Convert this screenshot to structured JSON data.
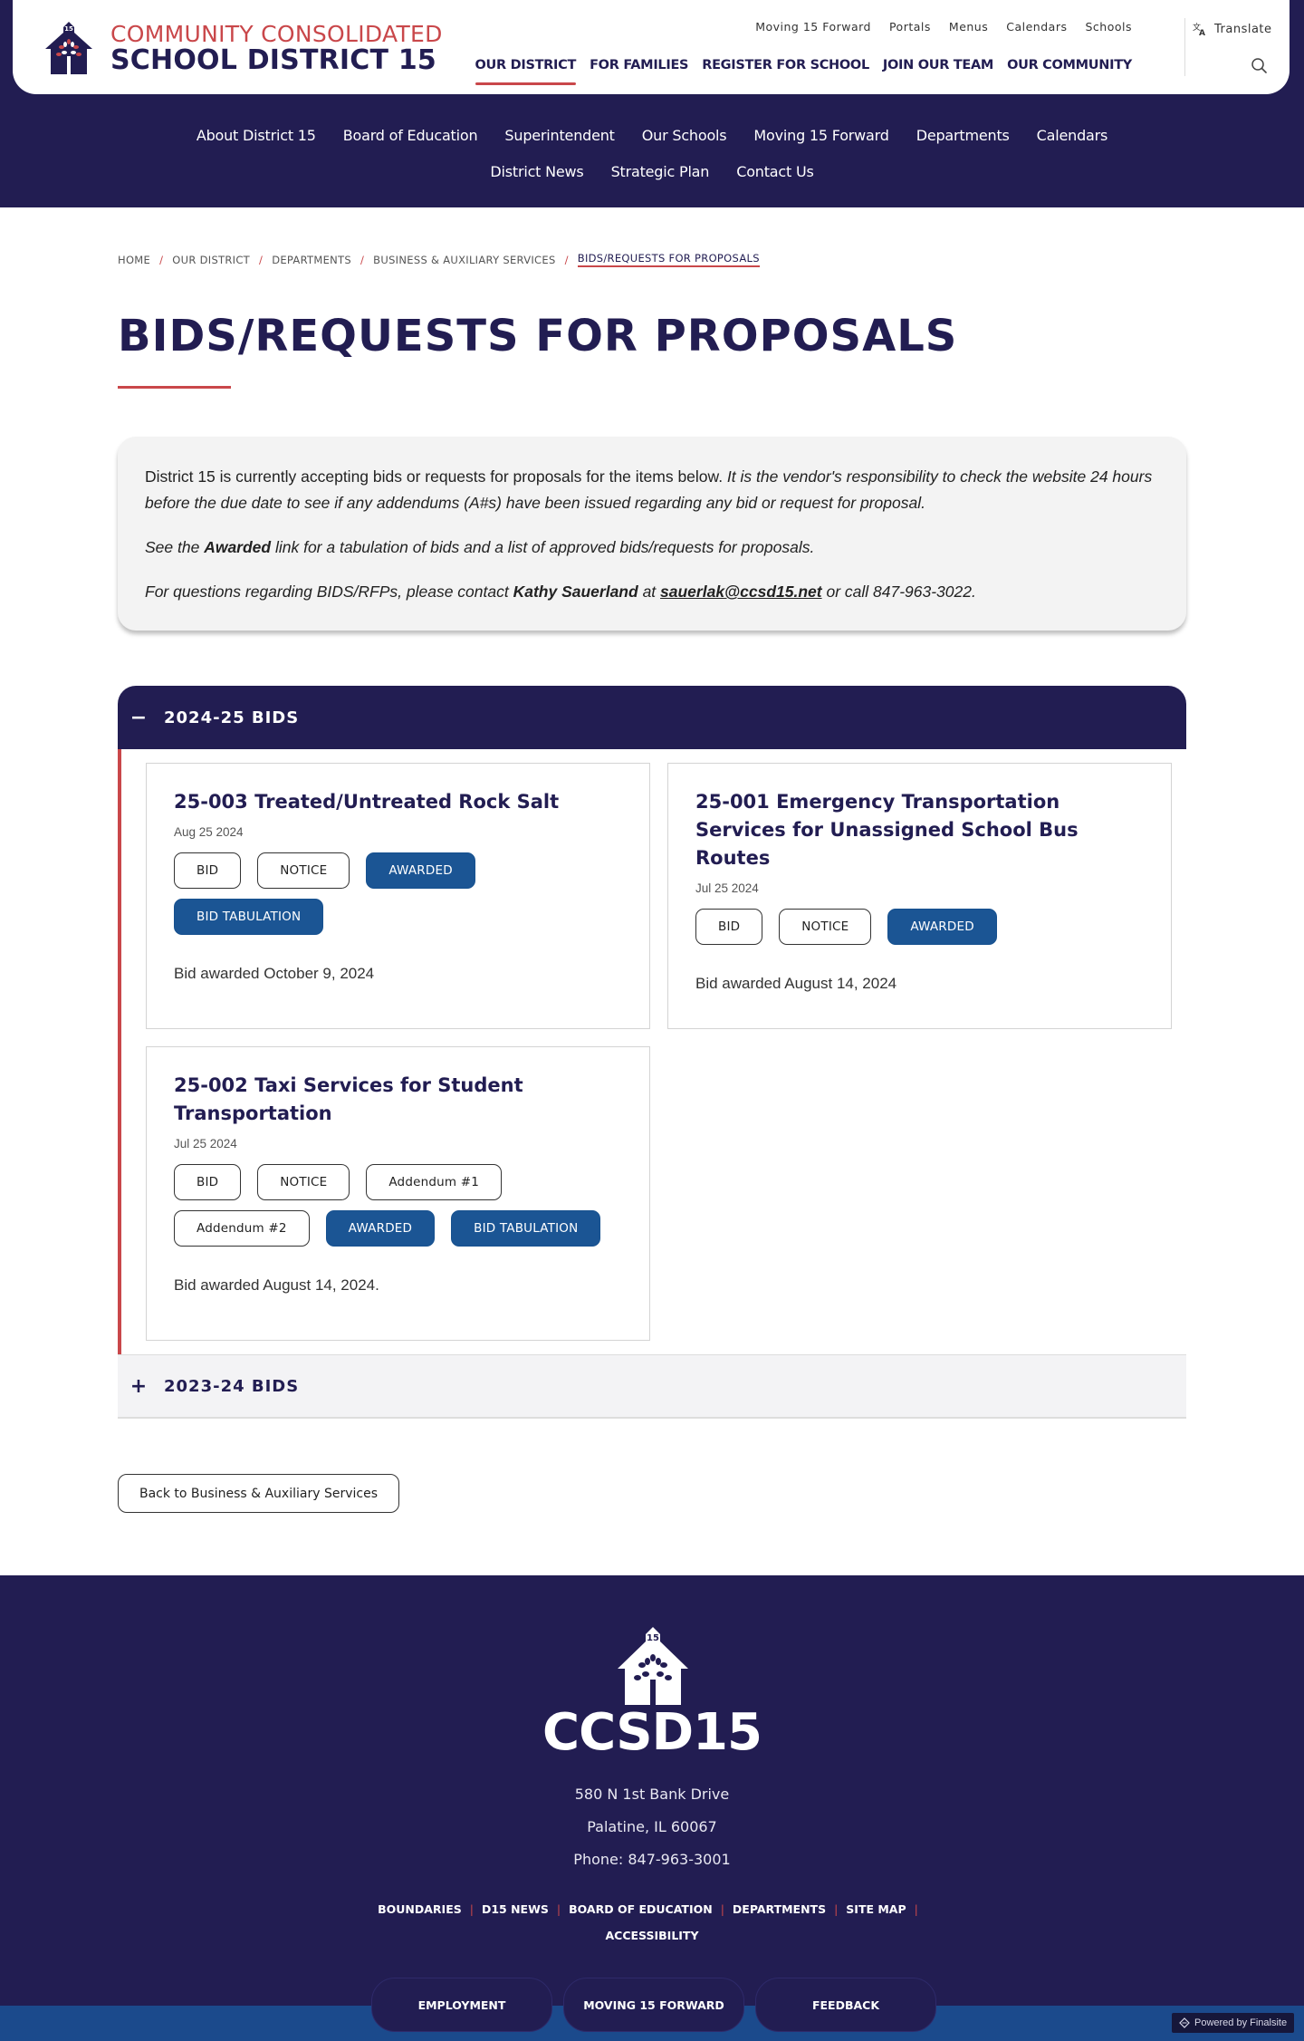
{
  "header": {
    "logo": {
      "line1": "COMMUNITY CONSOLIDATED",
      "line2": "SCHOOL DISTRICT 15",
      "badge": "15"
    },
    "utility_nav": [
      "Moving 15 Forward",
      "Portals",
      "Menus",
      "Calendars",
      "Schools"
    ],
    "main_nav": [
      {
        "label": "OUR DISTRICT",
        "active": true
      },
      {
        "label": "FOR FAMILIES",
        "active": false
      },
      {
        "label": "REGISTER FOR SCHOOL",
        "active": false
      },
      {
        "label": "JOIN OUR TEAM",
        "active": false
      },
      {
        "label": "OUR COMMUNITY",
        "active": false
      }
    ],
    "translate_label": "Translate",
    "search_icon": "search-icon",
    "translate_icon": "translate-icon"
  },
  "sub_nav": [
    "About District 15",
    "Board of Education",
    "Superintendent",
    "Our Schools",
    "Moving 15 Forward",
    "Departments",
    "Calendars",
    "District News",
    "Strategic Plan",
    "Contact Us"
  ],
  "breadcrumb": [
    "HOME",
    "OUR DISTRICT",
    "DEPARTMENTS",
    "BUSINESS & AUXILIARY SERVICES",
    "BIDS/REQUESTS FOR PROPOSALS"
  ],
  "page_title": "BIDS/REQUESTS FOR PROPOSALS",
  "intro": {
    "p1_normal": "District 15 is currently accepting bids or requests for proposals for the items below. ",
    "p1_italic": "It is the vendor's responsibility to check the website 24 hours before the due date to see if any addendums (A#s) have been issued regarding any bid or request for proposal.",
    "p2_pre": "See the ",
    "p2_bold": "Awarded",
    "p2_post": " link for a tabulation of bids and a list of approved bids/requests for proposals.",
    "p3_pre": "For questions regarding BIDS/RFPs, please contact ",
    "p3_name": "Kathy Sauerland",
    "p3_mid": " at ",
    "p3_email": "sauerlak@ccsd15.net",
    "p3_post": " or call 847-963-3022."
  },
  "accordions": [
    {
      "title": "2024-25 BIDS",
      "expanded": true,
      "toggle": "−",
      "bids": [
        {
          "title": "25-003 Treated/Untreated Rock Salt",
          "date": "Aug 25 2024",
          "buttons": [
            {
              "label": "BID",
              "style": "outline"
            },
            {
              "label": "NOTICE",
              "style": "outline"
            },
            {
              "label": "AWARDED",
              "style": "solid"
            },
            {
              "label": "BID TABULATION",
              "style": "solid"
            }
          ],
          "note": "Bid awarded October 9, 2024"
        },
        {
          "title": "25-001 Emergency Transportation Services for Unassigned School Bus Routes",
          "date": "Jul 25 2024",
          "buttons": [
            {
              "label": "BID",
              "style": "outline"
            },
            {
              "label": "NOTICE",
              "style": "outline"
            },
            {
              "label": "AWARDED",
              "style": "solid"
            }
          ],
          "note": "Bid awarded August 14, 2024"
        },
        {
          "title": "25-002 Taxi Services for Student Transportation",
          "date": "Jul 25 2024",
          "buttons": [
            {
              "label": "BID",
              "style": "outline"
            },
            {
              "label": "NOTICE",
              "style": "outline"
            },
            {
              "label": "Addendum #1",
              "style": "outline"
            },
            {
              "label": "Addendum #2",
              "style": "outline"
            },
            {
              "label": "AWARDED",
              "style": "solid"
            },
            {
              "label": "BID TABULATION",
              "style": "solid"
            }
          ],
          "note": "Bid awarded August 14, 2024."
        }
      ]
    },
    {
      "title": "2023-24 BIDS",
      "expanded": false,
      "toggle": "+"
    }
  ],
  "back_button": "Back to Business & Auxiliary Services",
  "footer": {
    "brand": "CCSD15",
    "badge": "15",
    "address_line1": "580 N 1st Bank Drive",
    "address_line2": "Palatine, IL  60067",
    "phone": "Phone: 847-963-3001",
    "links": [
      "BOUNDARIES",
      "D15 NEWS",
      "BOARD OF EDUCATION",
      "DEPARTMENTS",
      "SITE MAP",
      "ACCESSIBILITY"
    ],
    "pills": [
      "EMPLOYMENT",
      "MOVING 15 FORWARD",
      "FEEDBACK"
    ],
    "powered_by": "Powered by Finalsite"
  },
  "colors": {
    "navy": "#221d52",
    "accent_red": "#c9474a",
    "button_blue": "#1b5594",
    "intro_bg": "#f3f3f3"
  }
}
